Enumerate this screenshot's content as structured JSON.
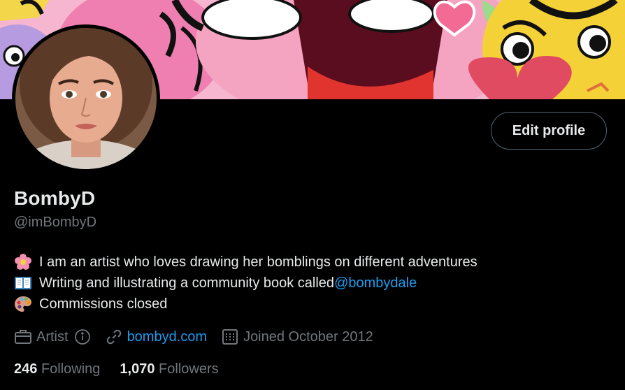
{
  "profile": {
    "display_name": "BombyD",
    "handle": "@imBombyD",
    "edit_label": "Edit profile"
  },
  "bio": {
    "line1": {
      "icon": "flower-emoji",
      "text": "I am an artist who loves drawing her bomblings on different adventures"
    },
    "line2": {
      "icon": "open-book-emoji",
      "text": "Writing and illustrating a community book called ",
      "link": "@bombydale"
    },
    "line3": {
      "icon": "palette-emoji",
      "text": "Commissions closed"
    }
  },
  "meta": {
    "profession": "Artist",
    "profession_icon": "briefcase-icon",
    "website": "bombyd.com",
    "website_icon": "link-icon",
    "joined": "Joined October 2012",
    "joined_icon": "calendar-icon"
  },
  "stats": {
    "following_count": "246",
    "following_label": "Following",
    "followers_count": "1,070",
    "followers_label": "Followers"
  },
  "colors": {
    "background": "#000000",
    "text": "#e7e9ea",
    "muted": "#71767b",
    "link": "#1d9bf0",
    "button_border": "#536471"
  }
}
